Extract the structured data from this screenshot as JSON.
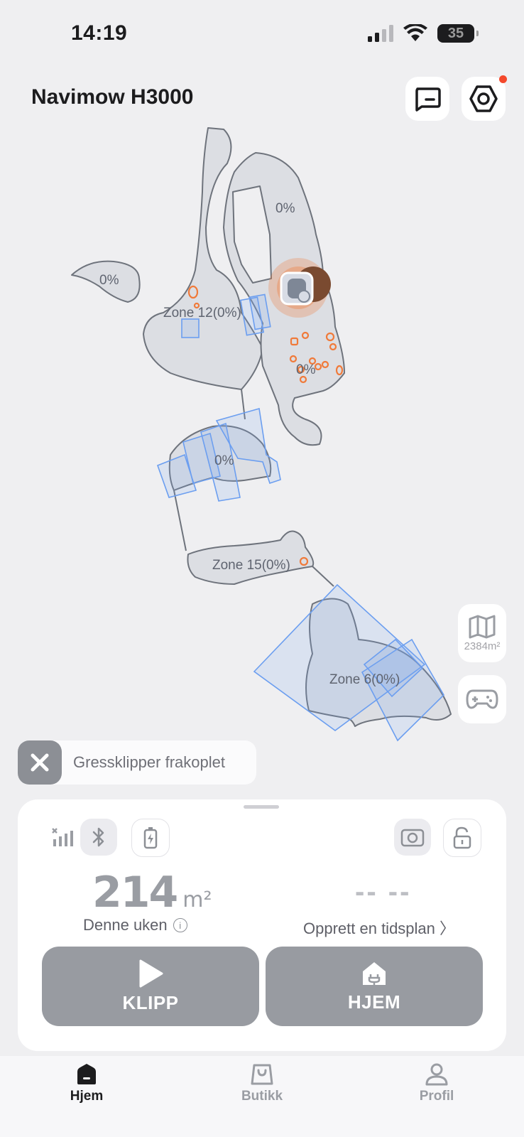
{
  "status_bar": {
    "time": "14:19",
    "battery": "35"
  },
  "header": {
    "title": "Navimow H3000"
  },
  "map": {
    "zone_labels": [
      "0%",
      "0%",
      "Zone 12(0%)",
      "0%",
      "0%",
      "Zone 15(0%)",
      "Zone 6(0%)"
    ],
    "area": "2384m²"
  },
  "toast": {
    "text": "Gressklipper frakoplet"
  },
  "panel": {
    "stat_value": "214",
    "stat_unit": "m²",
    "stat_label": "Denne uken",
    "schedule_value": "-- --",
    "schedule_label": "Opprett en tidsplan 〉",
    "mow_label": "KLIPP",
    "home_label": "HJEM"
  },
  "tabs": [
    {
      "label": "Hjem",
      "active": true
    },
    {
      "label": "Butikk",
      "active": false
    },
    {
      "label": "Profil",
      "active": false
    }
  ],
  "colors": {
    "accent_red": "#f4482b",
    "zone_blue": "#6b9ef0",
    "obstacle_orange": "#f07a3a"
  }
}
